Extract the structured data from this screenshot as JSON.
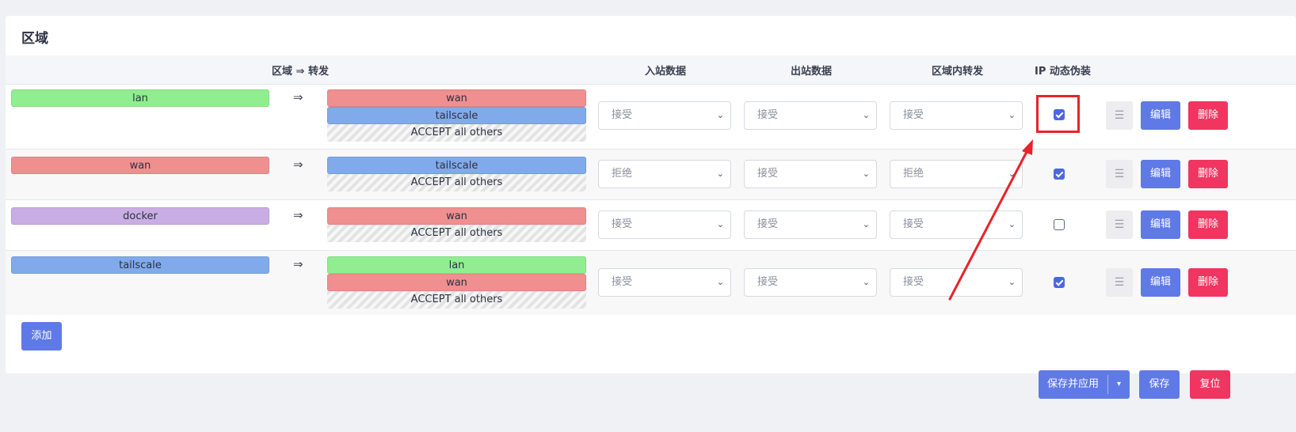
{
  "section": {
    "title": "区域"
  },
  "table": {
    "headers": {
      "zone_forward": "区域 ⇒ 转发",
      "input": "入站数据",
      "output": "出站数据",
      "intra": "区域内转发",
      "masq": "IP 动态伪装"
    },
    "rows": [
      {
        "zone": "lan",
        "arrow": "⇒",
        "forwards": [
          "wan",
          "tailscale"
        ],
        "others": "ACCEPT all others",
        "input": "接受",
        "output": "接受",
        "intra": "接受",
        "masq": true,
        "drag": "☰",
        "edit": "编辑",
        "delete": "删除"
      },
      {
        "zone": "wan",
        "arrow": "⇒",
        "forwards": [
          "tailscale"
        ],
        "others": "ACCEPT all others",
        "input": "拒绝",
        "output": "接受",
        "intra": "拒绝",
        "masq": true,
        "drag": "☰",
        "edit": "编辑",
        "delete": "删除"
      },
      {
        "zone": "docker",
        "arrow": "⇒",
        "forwards": [
          "wan"
        ],
        "others": "ACCEPT all others",
        "input": "接受",
        "output": "接受",
        "intra": "接受",
        "masq": false,
        "drag": "☰",
        "edit": "编辑",
        "delete": "删除"
      },
      {
        "zone": "tailscale",
        "arrow": "⇒",
        "forwards": [
          "lan",
          "wan"
        ],
        "others": "ACCEPT all others",
        "input": "接受",
        "output": "接受",
        "intra": "接受",
        "masq": true,
        "drag": "☰",
        "edit": "编辑",
        "delete": "删除"
      }
    ]
  },
  "add_button": "添加",
  "footer": {
    "save_apply": "保存并应用",
    "save_apply_caret": "▾",
    "save": "保存",
    "reset": "复位"
  },
  "icons": {
    "select_chevron": "chevron-down-icon",
    "drag": "drag-handle-icon",
    "checkbox": "checkbox-icon"
  },
  "colors": {
    "lan": "#90ee90",
    "wan": "#f08f8f",
    "tailscale": "#80aaea",
    "docker": "#c9aee3",
    "primary": "#5f7ae6",
    "danger": "#f03660",
    "annotation": "#e8232a"
  }
}
